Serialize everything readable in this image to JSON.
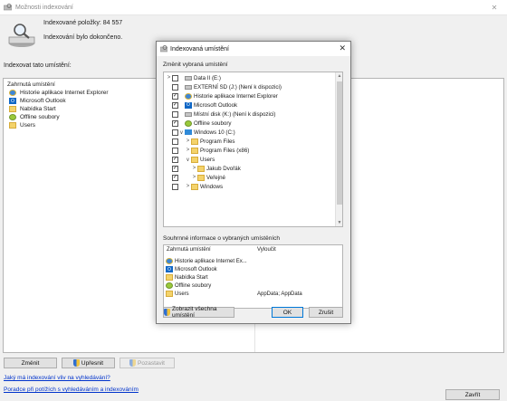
{
  "window": {
    "title": "Možnosti indexování",
    "indexed_items": "Indexované položky:  84 557",
    "status": "Indexování bylo dokončeno.",
    "section_label": "Indexovat tato umístění:",
    "list_header": "Zahrnutá umístění",
    "locations": [
      {
        "label": "Historie aplikace Internet Explorer",
        "icon": "ie-icon"
      },
      {
        "label": "Microsoft Outlook",
        "icon": "outlook-icon"
      },
      {
        "label": "Nabídka Start",
        "icon": "folder-icon"
      },
      {
        "label": "Offline soubory",
        "icon": "offline-icon"
      },
      {
        "label": "Users",
        "icon": "folder-icon"
      }
    ],
    "buttons": {
      "change": "Změnit",
      "advanced": "Upřesnit",
      "pause": "Pozastavit",
      "close": "Zavřít"
    },
    "links": [
      "Jaký má indexování vliv na vyhledávání?",
      "Poradce při potížích s vyhledáváním a indexováním"
    ]
  },
  "dialog": {
    "title": "Indexovaná umístění",
    "change_label": "Změnit vybraná umístění",
    "tree": [
      {
        "label": "Data II (E:)",
        "checked": false,
        "expand": ">",
        "icon": "drive-icon",
        "indent": 0
      },
      {
        "label": "EXTERNÍ SD (J:) (Není k dispozici)",
        "checked": false,
        "expand": "",
        "icon": "drive-icon",
        "indent": 0
      },
      {
        "label": "Historie aplikace Internet Explorer",
        "checked": true,
        "expand": "",
        "icon": "ie-icon",
        "indent": 0
      },
      {
        "label": "Microsoft Outlook",
        "checked": true,
        "expand": "",
        "icon": "outlook-icon",
        "indent": 0
      },
      {
        "label": "Místní disk (K:) (Není k dispozici)",
        "checked": false,
        "expand": "",
        "icon": "drive-icon",
        "indent": 0
      },
      {
        "label": "Offline soubory",
        "checked": true,
        "expand": "",
        "icon": "offline-icon",
        "indent": 0
      },
      {
        "label": "Windows 10 (C:)",
        "checked": false,
        "expand": "∨",
        "icon": "win-icon",
        "indent": 0
      },
      {
        "label": "Program Files",
        "checked": false,
        "expand": ">",
        "icon": "folder-icon",
        "indent": 1
      },
      {
        "label": "Program Files (x86)",
        "checked": false,
        "expand": ">",
        "icon": "folder-icon",
        "indent": 1
      },
      {
        "label": "Users",
        "checked": true,
        "expand": "∨",
        "icon": "folder-icon",
        "indent": 1
      },
      {
        "label": "Jakub Dvořák",
        "checked": true,
        "expand": ">",
        "icon": "folder-icon",
        "indent": 2
      },
      {
        "label": "Veřejné",
        "checked": true,
        "expand": ">",
        "icon": "folder-icon",
        "indent": 2
      },
      {
        "label": "Windows",
        "checked": false,
        "expand": ">",
        "icon": "folder-icon",
        "indent": 1
      }
    ],
    "summary_label": "Souhrnné informace o vybraných umístěních",
    "summary_head_included": "Zahrnutá umístění",
    "summary_head_excluded": "Vyloučit",
    "summary": [
      {
        "label": "Historie aplikace Internet Ex...",
        "icon": "ie-icon",
        "excluded": ""
      },
      {
        "label": "Microsoft Outlook",
        "icon": "outlook-icon",
        "excluded": ""
      },
      {
        "label": "Nabídka Start",
        "icon": "folder-icon",
        "excluded": ""
      },
      {
        "label": "Offline soubory",
        "icon": "offline-icon",
        "excluded": ""
      },
      {
        "label": "Users",
        "icon": "folder-icon",
        "excluded": "AppData; AppData"
      }
    ],
    "buttons": {
      "show_all": "Zobrazit všechna umístění",
      "ok": "OK",
      "cancel": "Zrušit"
    }
  }
}
